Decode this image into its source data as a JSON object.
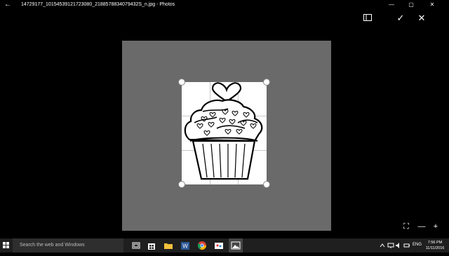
{
  "titlebar": {
    "back_glyph": "←",
    "title": "14729177_10154539121723080_2188578834079432S_n.jpg - Photos",
    "minimize": "—",
    "maximize": "▢",
    "close": "✕"
  },
  "toolbar": {
    "aspect_icon": "aspect-ratio-icon",
    "done_glyph": "✓",
    "cancel_glyph": "✕"
  },
  "zoom": {
    "fit_glyph": "⛶",
    "zoom_out_glyph": "—",
    "zoom_in_glyph": "+"
  },
  "taskbar": {
    "search_placeholder": "Search the web and Windows",
    "apps": [
      "task-view-icon",
      "store-icon",
      "file-explorer-icon",
      "word-icon",
      "chrome-icon",
      "paint-icon",
      "photos-icon"
    ],
    "language": "ENG",
    "time": "7:56 PM",
    "date": "11/11/2016"
  },
  "colors": {
    "background": "#000000",
    "canvas": "#6a6a6a",
    "taskbar": "#1f1f1f"
  }
}
